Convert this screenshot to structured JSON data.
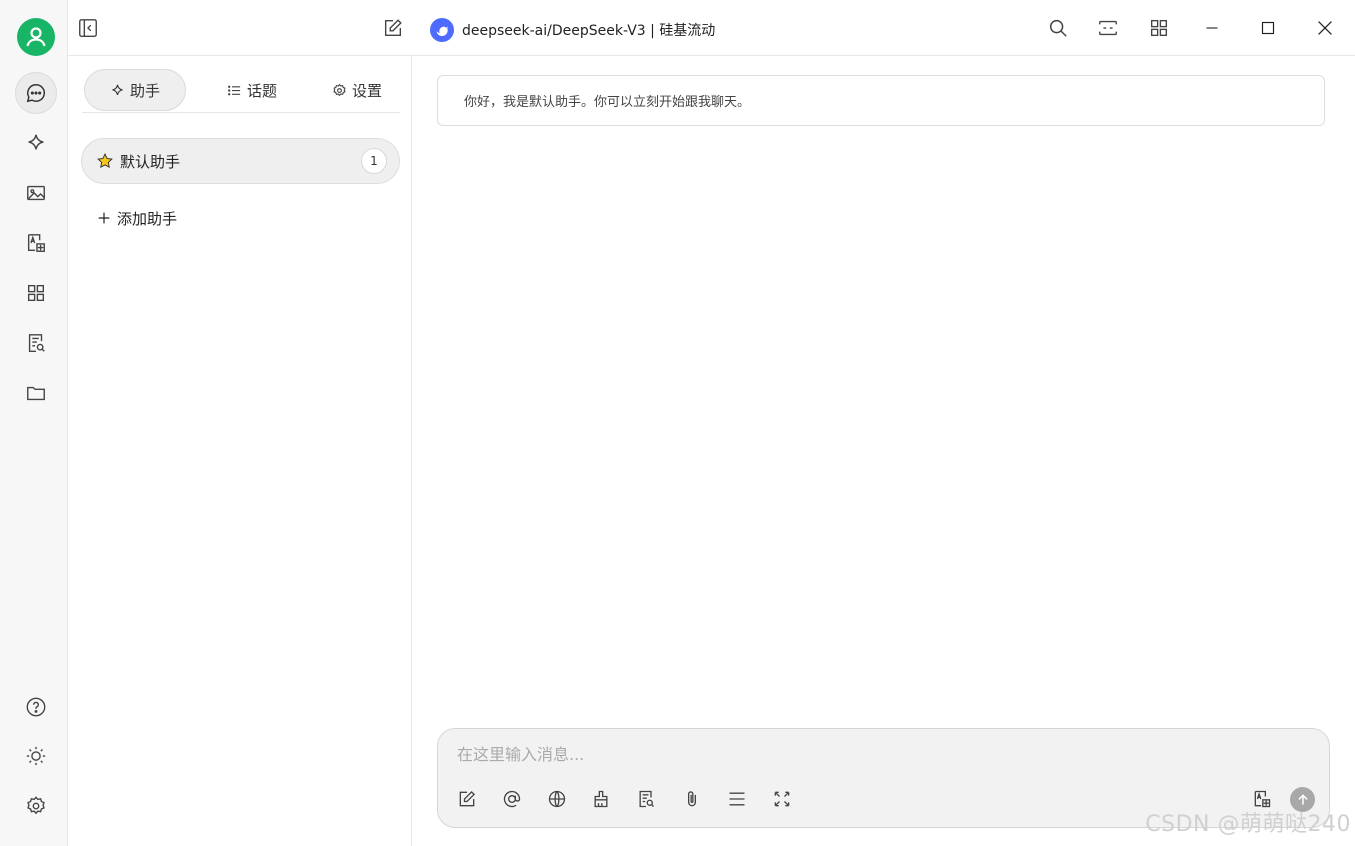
{
  "window": {
    "model_title": "deepseek-ai/DeepSeek-V3 | 硅基流动"
  },
  "rail": {
    "items": [
      {
        "icon": "chat-bubble-icon",
        "active": true
      },
      {
        "icon": "sparkle-icon",
        "active": false
      },
      {
        "icon": "image-icon",
        "active": false
      },
      {
        "icon": "translate-icon",
        "active": false
      },
      {
        "icon": "apps-grid-icon",
        "active": false
      },
      {
        "icon": "knowledge-search-icon",
        "active": false
      },
      {
        "icon": "folder-icon",
        "active": false
      }
    ],
    "bottom": [
      "help-icon",
      "theme-sun-icon",
      "settings-gear-icon"
    ]
  },
  "panel": {
    "tabs": [
      {
        "label": "助手",
        "icon": "sparkle-icon",
        "active": true
      },
      {
        "label": "话题",
        "icon": "list-icon",
        "active": false
      },
      {
        "label": "设置",
        "icon": "gear-icon",
        "active": false
      }
    ],
    "assistants": [
      {
        "name": "默认助手",
        "icon": "star-icon",
        "count": "1"
      }
    ],
    "add_label": "添加助手"
  },
  "chat": {
    "greeting": "你好，我是默认助手。你可以立刻开始跟我聊天。",
    "input_placeholder": "在这里输入消息..."
  },
  "watermark": "CSDN @萌萌哒240",
  "colors": {
    "avatar": "#18b566",
    "deepseek_logo": "#4d6bfe",
    "star": "#f5c518"
  }
}
